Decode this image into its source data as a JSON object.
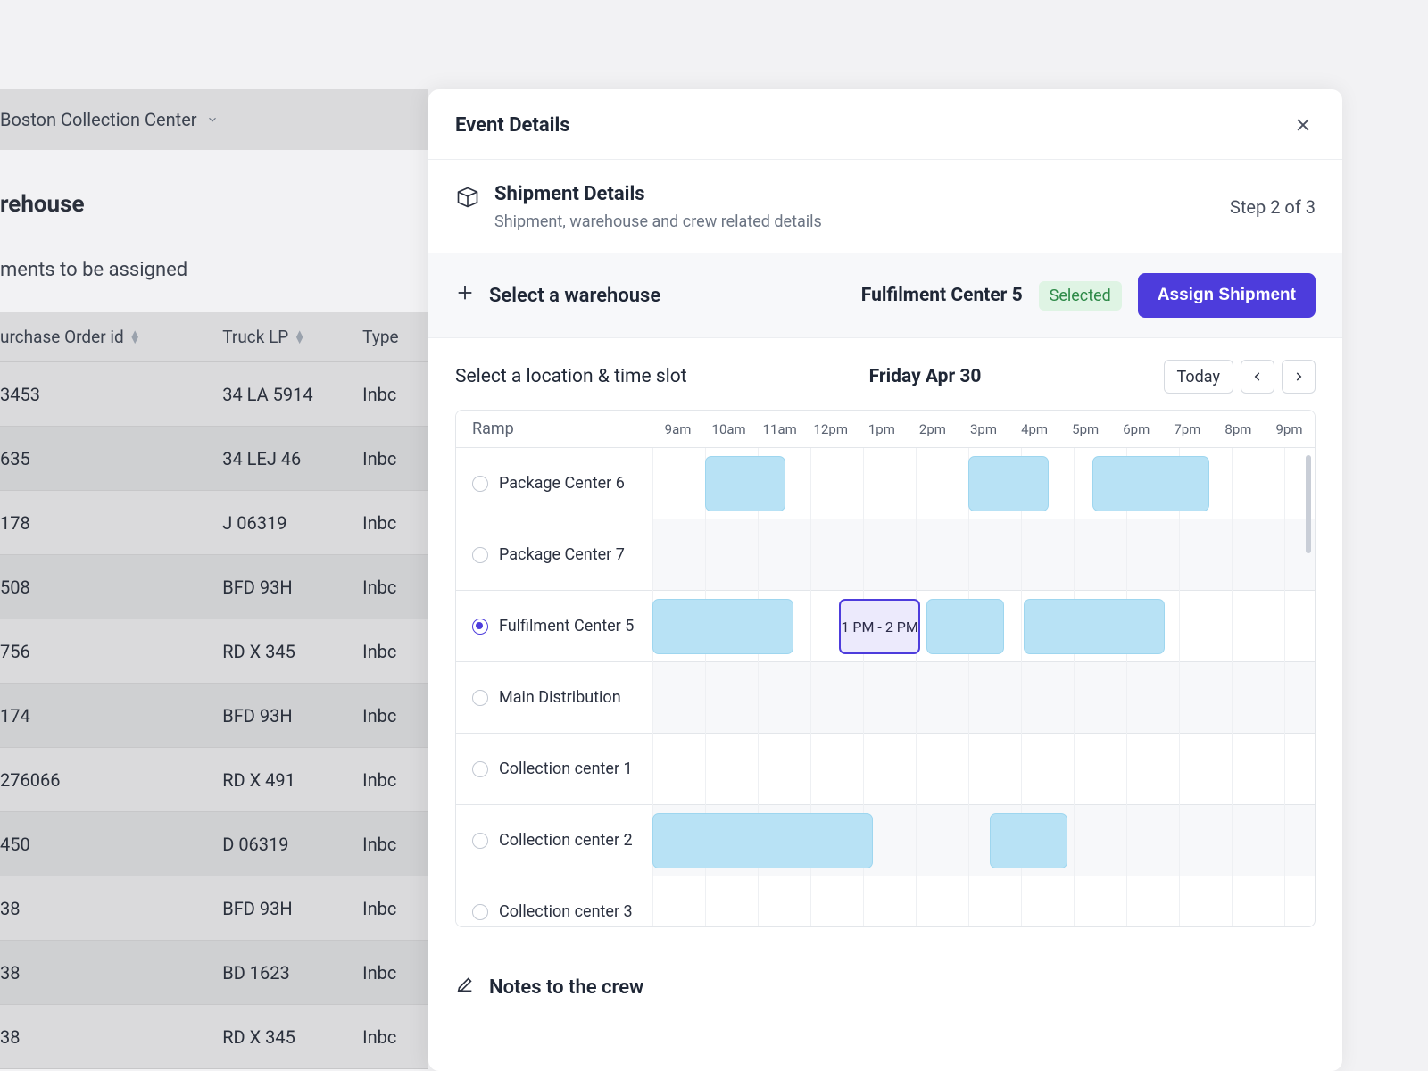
{
  "background": {
    "location": "Boston Collection Center",
    "page_title": "rehouse",
    "subtitle": "ments to be assigned",
    "columns": {
      "po": "urchase Order id",
      "lp": "Truck LP",
      "type": "Type"
    },
    "rows": [
      {
        "po": "3453",
        "lp": "34 LA 5914",
        "type": "Inbc"
      },
      {
        "po": "635",
        "lp": "34 LEJ 46",
        "type": "Inbc"
      },
      {
        "po": "178",
        "lp": "J 06319",
        "type": "Inbc"
      },
      {
        "po": "508",
        "lp": "BFD 93H",
        "type": "Inbc"
      },
      {
        "po": "756",
        "lp": "RD X 345",
        "type": "Inbc"
      },
      {
        "po": "174",
        "lp": "BFD 93H",
        "type": "Inbc"
      },
      {
        "po": "276066",
        "lp": "RD X 491",
        "type": "Inbc"
      },
      {
        "po": "450",
        "lp": "D 06319",
        "type": "Inbc"
      },
      {
        "po": "38",
        "lp": "BFD 93H",
        "type": "Inbc"
      },
      {
        "po": "38",
        "lp": "BD 1623",
        "type": "Inbc"
      },
      {
        "po": "38",
        "lp": "RD X 345",
        "type": "Inbc"
      }
    ]
  },
  "modal": {
    "title": "Event Details",
    "step_title": "Shipment Details",
    "step_desc": "Shipment, warehouse and crew related details",
    "step_counter": "Step 2 of 3",
    "select_warehouse_label": "Select a warehouse",
    "warehouse_name": "Fulfilment Center 5",
    "selected_label": "Selected",
    "assign_label": "Assign Shipment",
    "location_prompt": "Select a location & time slot",
    "date_label": "Friday Apr 30",
    "today_label": "Today",
    "ramp_header": "Ramp",
    "time_labels": [
      "9am",
      "10am",
      "11am",
      "12pm",
      "1pm",
      "2pm",
      "3pm",
      "4pm",
      "5pm",
      "6pm",
      "7pm",
      "8pm",
      "9pm"
    ],
    "ramps": [
      "Package Center 6",
      "Package Center 7",
      "Fulfilment Center 5",
      "Main Distribution",
      "Collection center 1",
      "Collection center 2",
      "Collection center 3"
    ],
    "selected_ramp_index": 2,
    "selected_slot_label": "1 PM - 2 PM",
    "notes_label": "Notes to the crew"
  }
}
